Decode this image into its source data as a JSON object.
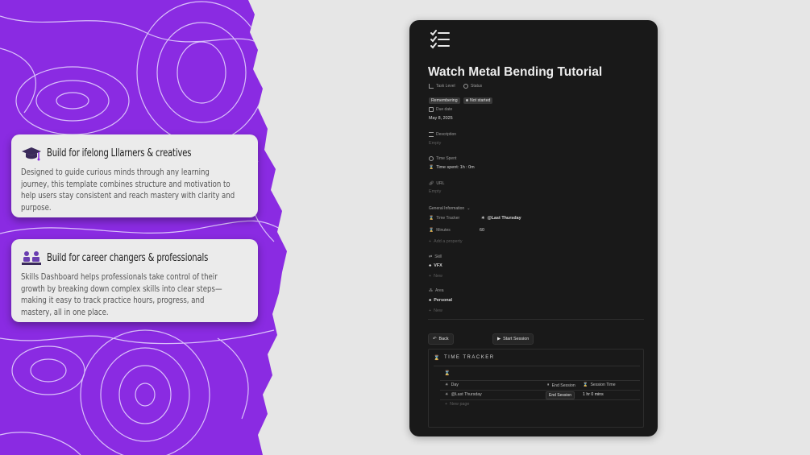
{
  "cards": [
    {
      "title": "Build for ifelong Lllarners & creatives",
      "body": "Designed to guide curious minds through any learning journey, this template combines structure and motivation to help users stay consistent and reach mastery with clarity and purpose.",
      "icon": "graduation-cap-icon"
    },
    {
      "title": "Build for career changers & professionals",
      "body": "Skills Dashboard helps professionals take control of their growth by breaking down complex skills into clear steps—making it easy to track practice hours, progress, and mastery, all in one place.",
      "icon": "professional-desk-icon"
    }
  ],
  "page": {
    "title": "Watch Metal Bending Tutorial",
    "task_level_label": "Task Level",
    "task_level_value": "Remembering",
    "status_label": "Status",
    "status_value": "Not started",
    "due_label": "Due date",
    "due_value": "May 8, 2025",
    "description_label": "Description",
    "description_value": "Empty",
    "time_spent_label": "Time Spent",
    "time_spent_value": "Time spent: 1h : 0m",
    "url_label": "URL",
    "url_value": "Empty",
    "general_info_label": "General Information",
    "time_tracker_label": "Time Tracker",
    "time_tracker_value": "@Last Thursday",
    "minutes_label": "Minutes",
    "minutes_value": "60",
    "add_property": "Add a property",
    "skill_label": "Skill",
    "skill_value": "VFX",
    "skill_new": "New",
    "area_label": "Area",
    "area_value": "Personal",
    "area_new": "New",
    "back_button": "Back",
    "start_button": "Start Session"
  },
  "tracker": {
    "title": "TIME TRACKER",
    "columns": [
      "Day",
      "End Session",
      "Session Time"
    ],
    "row": {
      "day": "@Last Thursday",
      "end_button": "End Session",
      "session_time": "1 hr  0 mins"
    },
    "new_page": "New page"
  },
  "colors": {
    "purple": "#8a2be2",
    "dark_bg": "#191919",
    "card_bg": "#ebebeb"
  }
}
